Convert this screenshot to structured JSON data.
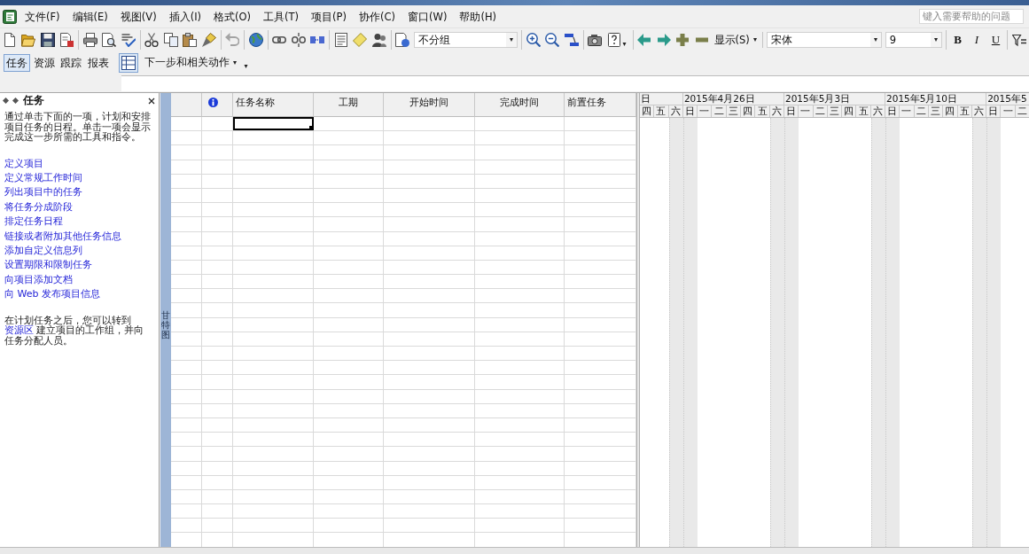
{
  "menu_bar": {
    "items": [
      "文件(F)",
      "编辑(E)",
      "视图(V)",
      "插入(I)",
      "格式(O)",
      "工具(T)",
      "项目(P)",
      "协作(C)",
      "窗口(W)",
      "帮助(H)"
    ],
    "help_search": {
      "placeholder": "键入需要帮助的问题"
    }
  },
  "standard_toolbar": {
    "groups": [
      {
        "items": [
          {
            "kind": "button",
            "disabled": false
          },
          {
            "kind": "button",
            "disabled": false
          },
          {
            "kind": "button",
            "disabled": false
          },
          {
            "kind": "button",
            "disabled": false
          }
        ]
      },
      {
        "items": [
          {
            "kind": "button",
            "disabled": false
          },
          {
            "kind": "button",
            "disabled": false
          },
          {
            "kind": "button",
            "disabled": false
          }
        ]
      },
      {
        "items": [
          {
            "kind": "button",
            "disabled": false
          },
          {
            "kind": "button",
            "disabled": false
          },
          {
            "kind": "button",
            "disabled": false
          },
          {
            "kind": "button",
            "disabled": false
          }
        ]
      },
      {
        "items": [
          {
            "kind": "button",
            "disabled": true
          }
        ]
      },
      {
        "items": [
          {
            "kind": "button",
            "disabled": false
          }
        ]
      },
      {
        "items": [
          {
            "kind": "button",
            "disabled": false
          },
          {
            "kind": "button",
            "disabled": false
          },
          {
            "kind": "button",
            "disabled": false
          }
        ]
      },
      {
        "items": [
          {
            "kind": "button",
            "disabled": false
          },
          {
            "kind": "button",
            "disabled": false
          },
          {
            "kind": "button",
            "disabled": false
          }
        ]
      },
      {
        "items": [
          {
            "kind": "button",
            "disabled": false
          },
          {
            "kind": "dropdown",
            "value": "不分组"
          }
        ]
      },
      {
        "items": [
          {
            "kind": "button",
            "disabled": false
          },
          {
            "kind": "button",
            "disabled": false
          },
          {
            "kind": "button",
            "disabled": false
          }
        ]
      },
      {
        "items": [
          {
            "kind": "button",
            "disabled": false
          },
          {
            "kind": "split-button",
            "disabled": false
          }
        ]
      },
      {
        "items": [
          {
            "kind": "button",
            "disabled": false
          },
          {
            "kind": "button",
            "disabled": false
          },
          {
            "kind": "button",
            "disabled": false
          },
          {
            "kind": "button",
            "disabled": false
          },
          {
            "kind": "menu",
            "label": "显示(S)"
          }
        ]
      },
      {
        "items": [
          {
            "kind": "dropdown",
            "value": "宋体"
          },
          {
            "kind": "dropdown",
            "value": "9"
          }
        ]
      },
      {
        "items": [
          {
            "kind": "glyph",
            "label": "B"
          },
          {
            "kind": "glyph",
            "label": "I"
          },
          {
            "kind": "glyph",
            "label": "U"
          }
        ]
      },
      {
        "items": [
          {
            "kind": "button",
            "disabled": false
          }
        ]
      }
    ]
  },
  "guide_toolbar": {
    "tabs": [
      {
        "label": "任务",
        "selected": true
      },
      {
        "label": "资源",
        "selected": false
      },
      {
        "label": "跟踪",
        "selected": false
      },
      {
        "label": "报表",
        "selected": false
      }
    ],
    "guide_button": {
      "on": true
    },
    "menu": {
      "label": "下一步和相关动作"
    }
  },
  "task_pane": {
    "title": "任务",
    "intro": "通过单击下面的一项，计划和安排项目任务的日程。单击一项会显示完成这一步所需的工具和指令。",
    "links": [
      "定义项目",
      "定义常规工作时间",
      "列出项目中的任务",
      "将任务分成阶段",
      "排定任务日程",
      "链接或者附加其他任务信息",
      "添加自定义信息列",
      "设置期限和限制任务",
      "向项目添加文档",
      "向 Web 发布项目信息"
    ],
    "note": {
      "before": "在计划任务之后，您可以转到 ",
      "link": "资源区",
      "after": " 建立项目的工作组，并向任务分配人员。"
    }
  },
  "view_bar": {
    "label": "甘特图"
  },
  "table": {
    "columns": [
      {
        "kind": "indicator"
      },
      {
        "kind": "text",
        "label": "任务名称"
      },
      {
        "kind": "duration",
        "label": "工期"
      },
      {
        "kind": "date",
        "label": "开始时间"
      },
      {
        "kind": "date",
        "label": "完成时间"
      },
      {
        "kind": "text",
        "label": "前置任务"
      }
    ],
    "rows": [
      {
        "selected": true
      },
      {
        "selected": false
      },
      {
        "selected": false
      },
      {
        "selected": false
      },
      {
        "selected": false
      },
      {
        "selected": false
      },
      {
        "selected": false
      },
      {
        "selected": false
      },
      {
        "selected": false
      },
      {
        "selected": false
      },
      {
        "selected": false
      },
      {
        "selected": false
      },
      {
        "selected": false
      },
      {
        "selected": false
      },
      {
        "selected": false
      },
      {
        "selected": false
      },
      {
        "selected": false
      },
      {
        "selected": false
      },
      {
        "selected": false
      },
      {
        "selected": false
      },
      {
        "selected": false
      },
      {
        "selected": false
      },
      {
        "selected": false
      },
      {
        "selected": false
      },
      {
        "selected": false
      },
      {
        "selected": false
      },
      {
        "selected": false
      },
      {
        "selected": false
      },
      {
        "selected": false
      },
      {
        "selected": false
      }
    ]
  },
  "gantt": {
    "weeks": [
      {
        "label": "日",
        "days": [
          {
            "label": "四",
            "nonworking": false
          },
          {
            "label": "五",
            "nonworking": false
          },
          {
            "label": "六",
            "nonworking": true
          }
        ]
      },
      {
        "label": "2015年4月26日",
        "days": [
          {
            "label": "日",
            "nonworking": true
          },
          {
            "label": "一",
            "nonworking": false
          },
          {
            "label": "二",
            "nonworking": false
          },
          {
            "label": "三",
            "nonworking": false
          },
          {
            "label": "四",
            "nonworking": false
          },
          {
            "label": "五",
            "nonworking": false
          },
          {
            "label": "六",
            "nonworking": true
          }
        ]
      },
      {
        "label": "2015年5月3日",
        "days": [
          {
            "label": "日",
            "nonworking": true
          },
          {
            "label": "一",
            "nonworking": false
          },
          {
            "label": "二",
            "nonworking": false
          },
          {
            "label": "三",
            "nonworking": false
          },
          {
            "label": "四",
            "nonworking": false
          },
          {
            "label": "五",
            "nonworking": false
          },
          {
            "label": "六",
            "nonworking": true
          }
        ]
      },
      {
        "label": "2015年5月10日",
        "days": [
          {
            "label": "日",
            "nonworking": true
          },
          {
            "label": "一",
            "nonworking": false
          },
          {
            "label": "二",
            "nonworking": false
          },
          {
            "label": "三",
            "nonworking": false
          },
          {
            "label": "四",
            "nonworking": false
          },
          {
            "label": "五",
            "nonworking": false
          },
          {
            "label": "六",
            "nonworking": true
          }
        ]
      },
      {
        "label": "2015年5",
        "days": [
          {
            "label": "日",
            "nonworking": true
          },
          {
            "label": "一",
            "nonworking": false
          },
          {
            "label": "二",
            "nonworking": false
          }
        ]
      }
    ]
  }
}
